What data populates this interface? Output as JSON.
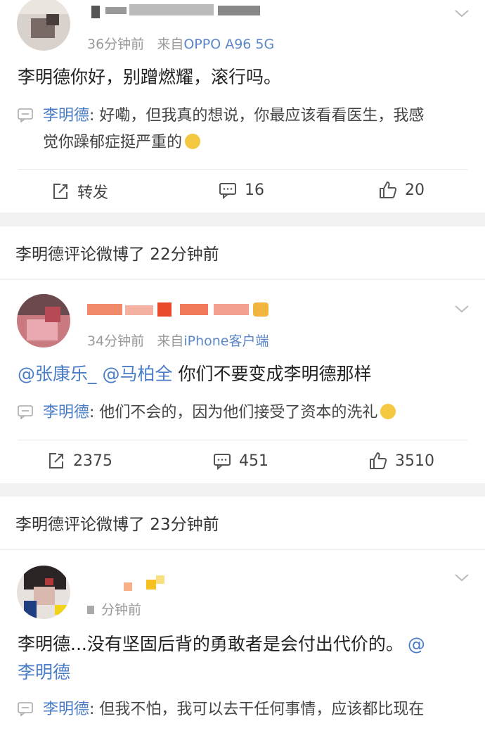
{
  "post1": {
    "meta_time": "36分钟前",
    "meta_from": "来自",
    "meta_source": "OPPO A96 5G",
    "text": "李明德你好，别蹭燃耀，滚行吗。",
    "reply_name": "李明德",
    "reply_text_l1": ": 好嘞，但我真的想说，你最应该看看医生，我感",
    "reply_text_l2": "觉你躁郁症挺严重的",
    "repost_label": "转发",
    "comment_count": "16",
    "like_count": "20"
  },
  "section2": {
    "header": "李明德评论微博了 22分钟前"
  },
  "post2": {
    "meta_time": "34分钟前",
    "meta_from": "来自",
    "meta_source": "iPhone客户端",
    "mention1": "@张康乐_",
    "mention2": "@马柏全",
    "text": "你们不要变成李明德那样",
    "reply_name": "李明德",
    "reply_text": ": 他们不会的，因为他们接受了资本的洗礼",
    "repost_count": "2375",
    "comment_count": "451",
    "like_count": "3510"
  },
  "section3": {
    "header": "李明德评论微博了 23分钟前"
  },
  "post3": {
    "meta_time": "分钟前",
    "text_l1": "李明德...没有坚固后背的勇敢者是会付出代价的。",
    "text_l1_mention": "@",
    "text_l2_mention": "李明德",
    "reply_name": "李明德",
    "reply_text": ": 但我不怕，我可以去干任何事情，应该都比现在"
  },
  "colors": {
    "link": "#4a7cc7",
    "meta": "#999999",
    "divider_bg": "#f2f2f2"
  }
}
